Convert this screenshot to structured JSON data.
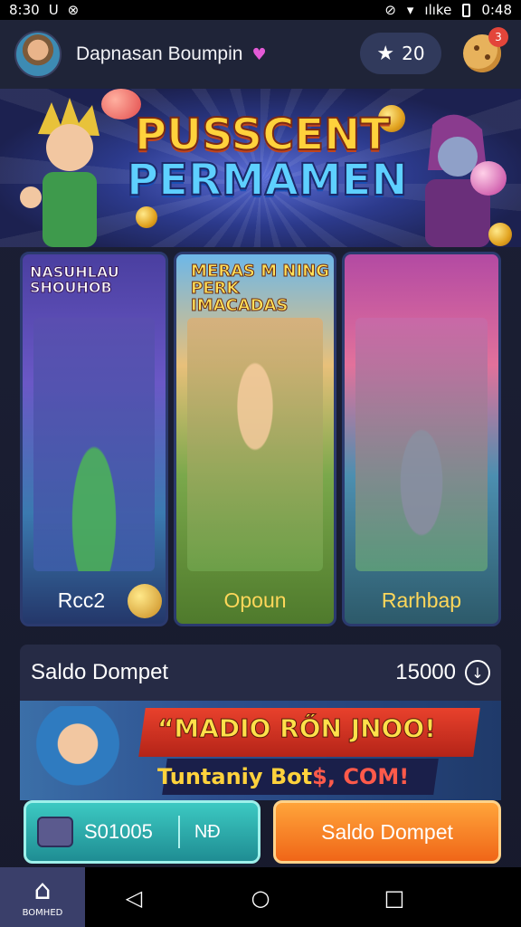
{
  "status_bar": {
    "time_left": "8:30",
    "icons_left": [
      "U",
      "⊗"
    ],
    "signal_text": "ılıke",
    "time_right": "0:48"
  },
  "header": {
    "user_name": "Dapnasan Boumpin",
    "heart": "♥",
    "star_count": "20",
    "notification_count": "3"
  },
  "hero": {
    "title_line1": "PUSSCENT",
    "title_line2": "PERMAMEN"
  },
  "cards": [
    {
      "caption": "NASUHLAU SHOUHOB",
      "label": "Rcc2"
    },
    {
      "caption": "MERAS M NING PERK IMACADAS",
      "label": "Opoun"
    },
    {
      "caption": "",
      "label": "Rarhbap"
    }
  ],
  "wallet": {
    "title": "Saldo Dompet",
    "amount": "15000"
  },
  "promo": {
    "line1": "“MADIO RŐN JNOO!",
    "line2_a": "Tuntaniy Bot",
    "line2_b": "$, COM!"
  },
  "buttons": {
    "code_value": "S01005",
    "code_suffix": "NĐ",
    "wallet_button": "Saldo Dompet"
  },
  "navbar": {
    "home_label": "BOMHED"
  },
  "colors": {
    "accent_orange": "#f06618",
    "accent_teal": "#1f8d93",
    "background": "#171a2c"
  }
}
